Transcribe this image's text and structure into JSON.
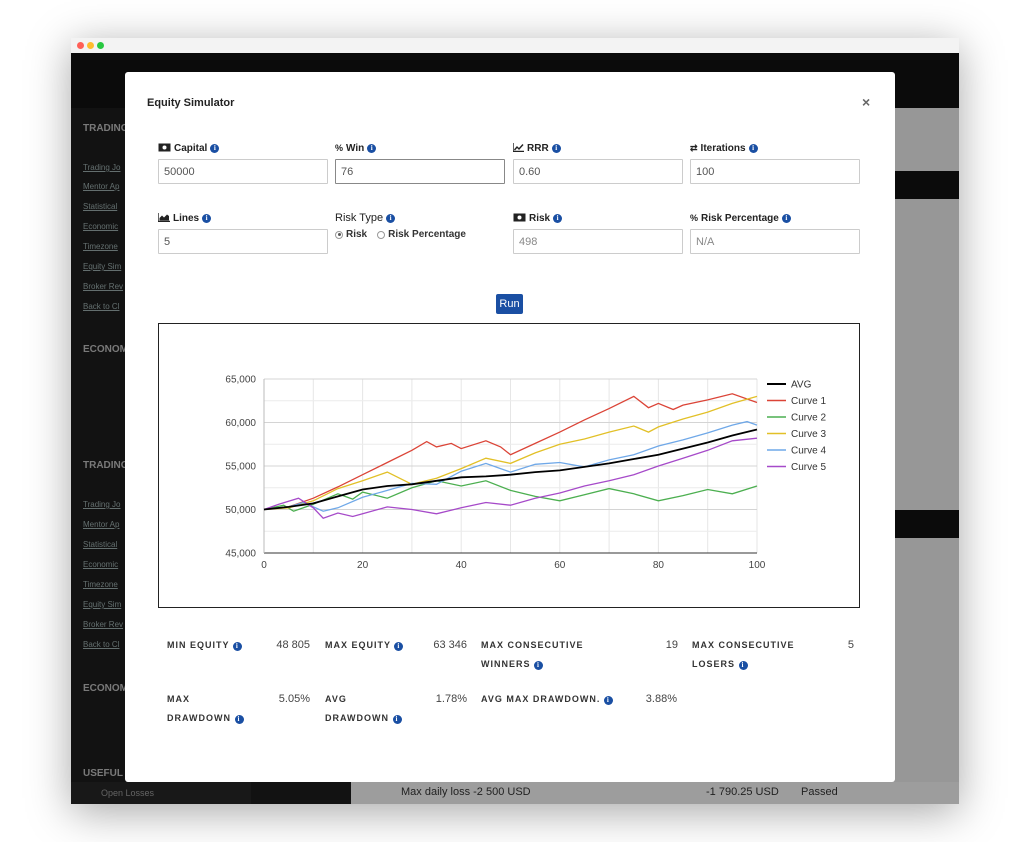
{
  "background": {
    "sidebar_heading_1": "TRADING",
    "sidebar_links": [
      "Trading Jo",
      "Mentor Ap",
      "Statistical",
      "Economic",
      "Timezone",
      "Equity Sim",
      "Broker Rev",
      "Back to Cl"
    ],
    "sidebar_heading_2": "ECONOM",
    "sidebar_heading_3": "TRADING",
    "sidebar_heading_4": "ECONOM",
    "sidebar_heading_5": "USEFUL",
    "open_losses": "Open Losses",
    "bottom_row": {
      "label": "Max daily loss -2 500 USD",
      "value": "-1 790.25 USD",
      "status": "Passed"
    }
  },
  "modal": {
    "title": "Equity Simulator",
    "close": "×",
    "fields": {
      "capital": {
        "label": "Capital",
        "value": "50000"
      },
      "win": {
        "label": "Win",
        "value": "76"
      },
      "rrr": {
        "label": "RRR",
        "value": "0.60"
      },
      "iterations": {
        "label": "Iterations",
        "value": "100"
      },
      "lines": {
        "label": "Lines",
        "value": "5"
      },
      "risk_type": {
        "label": "Risk Type",
        "option_risk": "Risk",
        "option_risk_pct": "Risk Percentage",
        "selected": "Risk"
      },
      "risk": {
        "label": "Risk",
        "value": "498"
      },
      "risk_percentage": {
        "label": "Risk Percentage",
        "value": "N/A"
      }
    },
    "run_label": "Run",
    "stats": {
      "min_equity": {
        "label": "MIN EQUITY",
        "value": "48 805"
      },
      "max_equity": {
        "label": "MAX EQUITY",
        "value": "63 346"
      },
      "max_consecutive_winners": {
        "label_1": "MAX CONSECUTIVE",
        "label_2": "WINNERS",
        "value": "19"
      },
      "max_consecutive_losers": {
        "label_1": "MAX CONSECUTIVE",
        "label_2": "LOSERS",
        "value": "5"
      },
      "max_drawdown": {
        "label_1": "MAX",
        "label_2": "DRAWDOWN",
        "value": "5.05%"
      },
      "avg_drawdown": {
        "label_1": "AVG",
        "label_2": "DRAWDOWN",
        "value": "1.78%"
      },
      "avg_max_drawdown": {
        "label": "AVG MAX DRAWDOWN.",
        "value": "3.88%"
      }
    }
  },
  "colors": {
    "primary": "#1a4fa3",
    "avg": "#000000",
    "curve1": "#db4437",
    "curve2": "#4caf50",
    "curve3": "#e2c027",
    "curve4": "#6fa8e8",
    "curve5": "#a64ac9"
  },
  "chart_data": {
    "type": "line",
    "xlim": [
      0,
      100
    ],
    "ylim": [
      45000,
      65000
    ],
    "x_ticks": [
      0,
      20,
      40,
      60,
      80,
      100
    ],
    "y_ticks": [
      45000,
      50000,
      55000,
      60000,
      65000
    ],
    "x_tick_labels": [
      "0",
      "20",
      "40",
      "60",
      "80",
      "100"
    ],
    "y_tick_labels": [
      "45,000",
      "50,000",
      "55,000",
      "60,000",
      "65,000"
    ],
    "grid": true,
    "legend_position": "right",
    "series": [
      {
        "name": "AVG",
        "color": "#000000",
        "points": [
          [
            0,
            50000
          ],
          [
            5,
            50300
          ],
          [
            10,
            50700
          ],
          [
            15,
            51500
          ],
          [
            20,
            52300
          ],
          [
            25,
            52700
          ],
          [
            30,
            52900
          ],
          [
            35,
            53300
          ],
          [
            40,
            53700
          ],
          [
            45,
            53800
          ],
          [
            50,
            54000
          ],
          [
            55,
            54300
          ],
          [
            60,
            54500
          ],
          [
            65,
            54900
          ],
          [
            70,
            55300
          ],
          [
            75,
            55800
          ],
          [
            80,
            56300
          ],
          [
            85,
            57000
          ],
          [
            90,
            57700
          ],
          [
            95,
            58500
          ],
          [
            100,
            59200
          ]
        ]
      },
      {
        "name": "Curve 1",
        "color": "#db4437",
        "points": [
          [
            0,
            50000
          ],
          [
            5,
            50300
          ],
          [
            10,
            51300
          ],
          [
            15,
            52600
          ],
          [
            20,
            54000
          ],
          [
            25,
            55400
          ],
          [
            30,
            56800
          ],
          [
            33,
            57800
          ],
          [
            35,
            57200
          ],
          [
            38,
            57600
          ],
          [
            40,
            57000
          ],
          [
            45,
            57900
          ],
          [
            48,
            57200
          ],
          [
            50,
            56300
          ],
          [
            55,
            57600
          ],
          [
            60,
            58900
          ],
          [
            65,
            60300
          ],
          [
            70,
            61600
          ],
          [
            75,
            63000
          ],
          [
            78,
            61700
          ],
          [
            80,
            62200
          ],
          [
            83,
            61500
          ],
          [
            85,
            62000
          ],
          [
            90,
            62600
          ],
          [
            95,
            63300
          ],
          [
            100,
            62300
          ]
        ]
      },
      {
        "name": "Curve 2",
        "color": "#4caf50",
        "points": [
          [
            0,
            50000
          ],
          [
            4,
            50500
          ],
          [
            6,
            49800
          ],
          [
            10,
            50600
          ],
          [
            15,
            51800
          ],
          [
            18,
            51200
          ],
          [
            20,
            52000
          ],
          [
            25,
            51300
          ],
          [
            30,
            52500
          ],
          [
            35,
            53300
          ],
          [
            40,
            52700
          ],
          [
            45,
            53300
          ],
          [
            50,
            52200
          ],
          [
            55,
            51500
          ],
          [
            60,
            51000
          ],
          [
            65,
            51700
          ],
          [
            70,
            52400
          ],
          [
            75,
            51800
          ],
          [
            80,
            51000
          ],
          [
            85,
            51600
          ],
          [
            90,
            52300
          ],
          [
            95,
            51800
          ],
          [
            100,
            52700
          ]
        ]
      },
      {
        "name": "Curve 3",
        "color": "#e2c027",
        "points": [
          [
            0,
            50000
          ],
          [
            5,
            50200
          ],
          [
            10,
            51000
          ],
          [
            15,
            52400
          ],
          [
            20,
            53300
          ],
          [
            25,
            54300
          ],
          [
            30,
            52900
          ],
          [
            35,
            53600
          ],
          [
            40,
            54700
          ],
          [
            45,
            55900
          ],
          [
            50,
            55300
          ],
          [
            55,
            56500
          ],
          [
            60,
            57500
          ],
          [
            65,
            58100
          ],
          [
            70,
            58900
          ],
          [
            75,
            59600
          ],
          [
            78,
            58900
          ],
          [
            80,
            59500
          ],
          [
            85,
            60400
          ],
          [
            90,
            61200
          ],
          [
            95,
            62200
          ],
          [
            100,
            63000
          ]
        ]
      },
      {
        "name": "Curve 4",
        "color": "#6fa8e8",
        "points": [
          [
            0,
            50000
          ],
          [
            5,
            50300
          ],
          [
            8,
            50800
          ],
          [
            12,
            49800
          ],
          [
            15,
            50200
          ],
          [
            20,
            51400
          ],
          [
            25,
            52200
          ],
          [
            30,
            53000
          ],
          [
            35,
            52900
          ],
          [
            40,
            54400
          ],
          [
            45,
            55300
          ],
          [
            48,
            54700
          ],
          [
            50,
            54300
          ],
          [
            55,
            55200
          ],
          [
            60,
            55400
          ],
          [
            65,
            54900
          ],
          [
            70,
            55700
          ],
          [
            75,
            56300
          ],
          [
            80,
            57300
          ],
          [
            85,
            58000
          ],
          [
            90,
            58800
          ],
          [
            95,
            59700
          ],
          [
            98,
            60100
          ],
          [
            100,
            59700
          ]
        ]
      },
      {
        "name": "Curve 5",
        "color": "#a64ac9",
        "points": [
          [
            0,
            50000
          ],
          [
            3,
            50600
          ],
          [
            7,
            51300
          ],
          [
            10,
            50200
          ],
          [
            12,
            49000
          ],
          [
            15,
            49600
          ],
          [
            18,
            49200
          ],
          [
            20,
            49500
          ],
          [
            25,
            50300
          ],
          [
            30,
            50000
          ],
          [
            35,
            49500
          ],
          [
            40,
            50200
          ],
          [
            45,
            50800
          ],
          [
            50,
            50500
          ],
          [
            55,
            51300
          ],
          [
            60,
            51900
          ],
          [
            65,
            52700
          ],
          [
            70,
            53300
          ],
          [
            75,
            54000
          ],
          [
            80,
            55000
          ],
          [
            85,
            55900
          ],
          [
            90,
            56800
          ],
          [
            95,
            57900
          ],
          [
            100,
            58200
          ]
        ]
      }
    ]
  }
}
